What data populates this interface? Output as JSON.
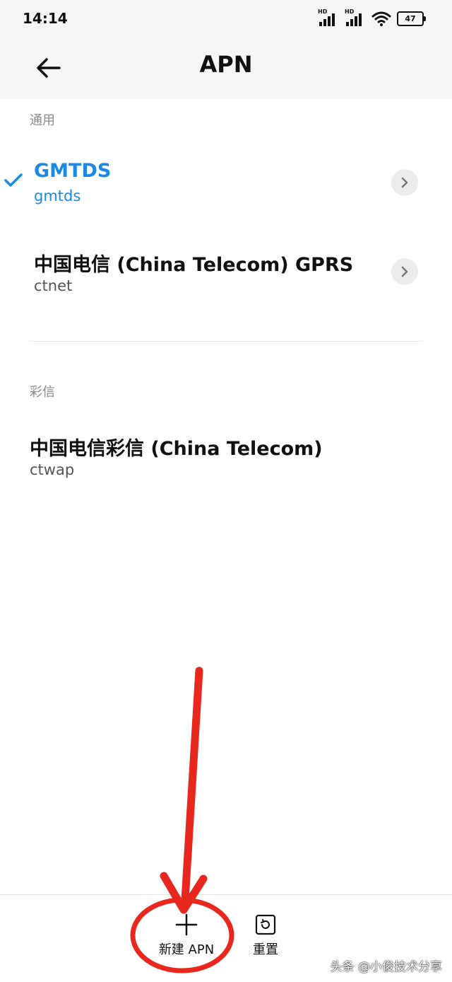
{
  "status_bar": {
    "time": "14:14",
    "battery": "47",
    "hd_label": "HD"
  },
  "header": {
    "title": "APN",
    "back_icon": "arrow-left-icon"
  },
  "sections": [
    {
      "label": "通用",
      "items": [
        {
          "title": "GMTDS",
          "subtitle": "gmtds",
          "selected": true
        },
        {
          "title": "中国电信 (China Telecom) GPRS",
          "subtitle": "ctnet",
          "selected": false
        }
      ]
    },
    {
      "label": "彩信",
      "items": [
        {
          "title": "中国电信彩信 (China Telecom)",
          "subtitle": "ctwap",
          "selected": false
        }
      ]
    }
  ],
  "bottom_actions": [
    {
      "label": "新建 APN",
      "icon": "plus-icon"
    },
    {
      "label": "重置",
      "icon": "reset-icon"
    }
  ],
  "watermark": "头条 @小俊技术分享",
  "colors": {
    "accent": "#1a8ae5",
    "annotation": "#e8271f",
    "header_bg": "#f6f6f6"
  }
}
